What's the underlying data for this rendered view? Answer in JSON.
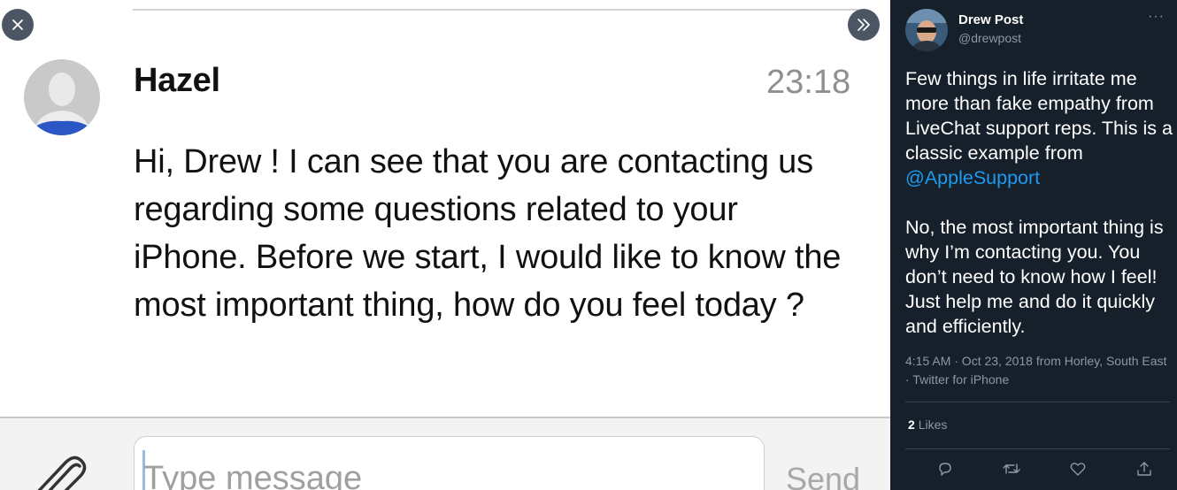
{
  "viewer": {
    "close_icon": "close-icon",
    "next_icon": "double-chevron-right-icon"
  },
  "chat": {
    "agent_name": "Hazel",
    "time": "23:18",
    "message": "Hi, Drew ! I can see that you are contacting us regarding some questions related to your iPhone. Before we start, I would like to know the most important thing, how do you feel today ?",
    "input_placeholder": "Type message",
    "send_label": "Send"
  },
  "tweet": {
    "author_name": "Drew Post",
    "author_handle": "@drewpost",
    "para1_text": "Few things in life irritate me more than fake empathy from LiveChat support reps. This is a classic example from ",
    "para1_mention": "@AppleSupport",
    "para2_text": "No, the most important thing is why I’m contacting you. You don’t need to know how I feel! Just help me and do it quickly and efficiently.",
    "meta_line": "4:15 AM · Oct 23, 2018 from Horley, South East · Twitter for iPhone",
    "likes_count": "2",
    "likes_label": "Likes",
    "more_label": "···"
  },
  "colors": {
    "tweet_bg": "#15202b",
    "link": "#1d9bf0",
    "muted": "#8b98a5",
    "agent_avatar_shirt": "#2b56c6"
  }
}
